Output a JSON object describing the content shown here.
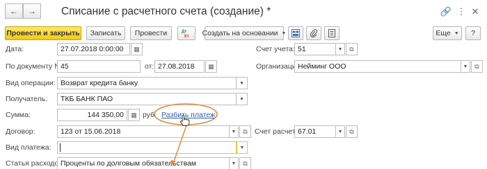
{
  "window": {
    "title": "Списание с расчетного счета (создание) *"
  },
  "toolbar": {
    "post_close": "Провести и закрыть",
    "save": "Записать",
    "post": "Провести",
    "create_based": "Создать на основании",
    "more": "Еще",
    "help": "?"
  },
  "form": {
    "date_label": "Дата:",
    "date_value": "27.07.2018  0:00:00",
    "account_label": "Счет учета:",
    "account_value": "51",
    "doc_num_label": "По документу №:",
    "doc_num_value": "45",
    "from_label": "от:",
    "from_value": "27.08.2018",
    "org_label": "Организация:",
    "org_value": "Нейминг ООО",
    "op_type_label": "Вид операции:",
    "op_type_value": "Возврат кредита банку",
    "recipient_label": "Получатель:",
    "recipient_value": "ТКБ БАНК ПАО",
    "sum_label": "Сумма:",
    "sum_value": "144 350,00",
    "currency": "руб.",
    "split_payment": "Разбить платеж",
    "contract_label": "Договор:",
    "contract_value": "123 от 15.06.2018",
    "calc_account_label": "Счет расчетов:",
    "calc_account_value": "67.01",
    "payment_type_label": "Вид платежа:",
    "payment_type_value": "",
    "expense_label": "Статья расходов:",
    "expense_value": "Проценты по долговым обязательствам"
  },
  "colors": {
    "primary_button": "#f2c912",
    "link": "#2a5ea8",
    "annotation": "#e08a3c"
  }
}
